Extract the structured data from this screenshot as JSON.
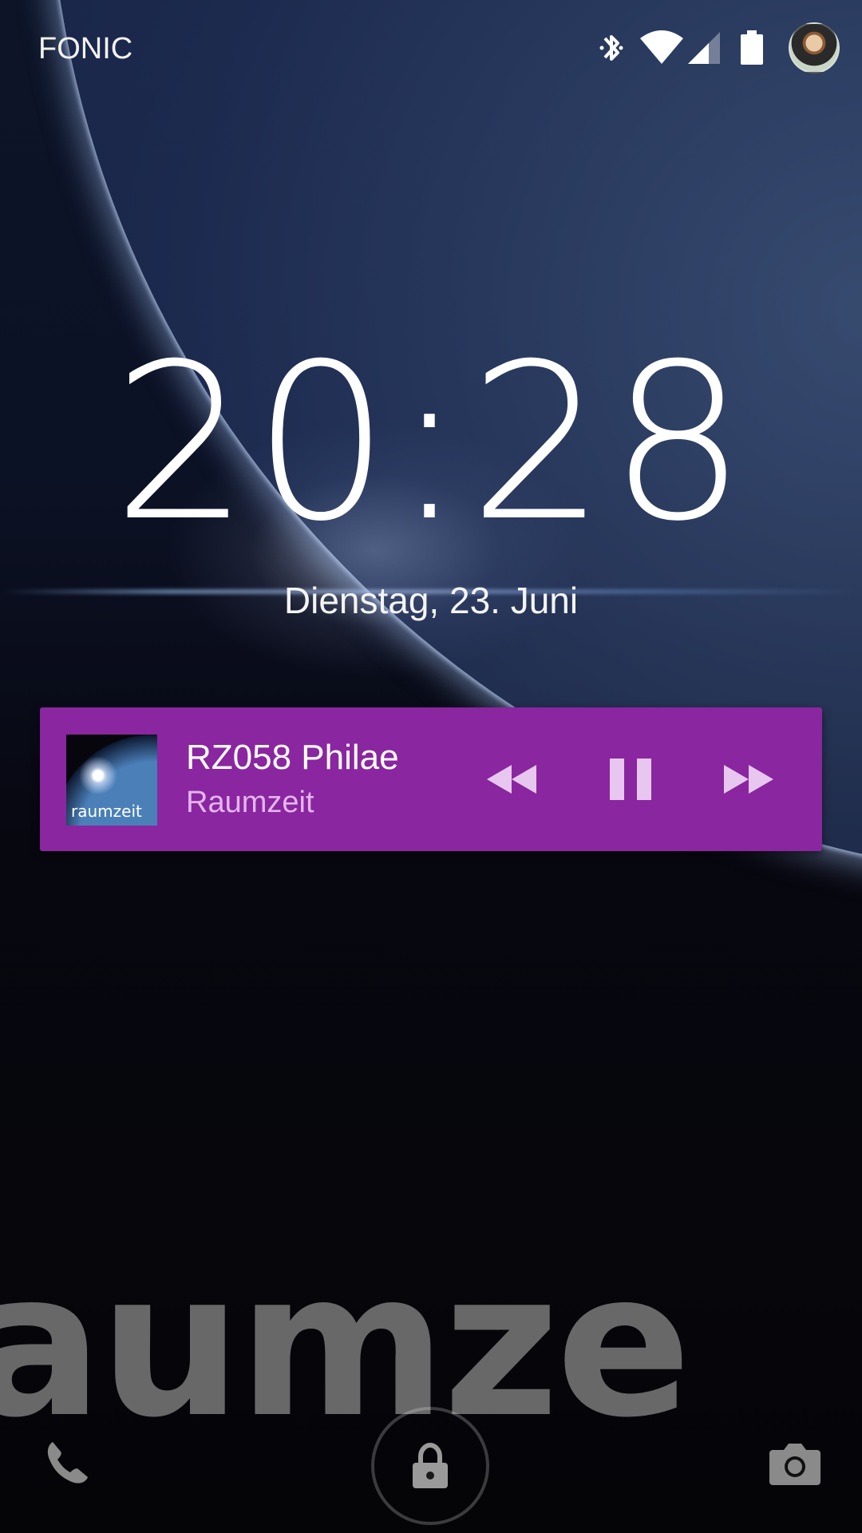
{
  "status_bar": {
    "carrier": "FONIC",
    "icons": [
      "bluetooth-icon",
      "wifi-icon",
      "cell-signal-icon",
      "battery-icon",
      "user-avatar"
    ]
  },
  "lockscreen": {
    "time": "20:28",
    "date": "Dienstag, 23. Juni"
  },
  "media_notification": {
    "title": "RZ058 Philae",
    "artist": "Raumzeit",
    "album_art_text": "raumzeit",
    "background_color": "#8a26a0",
    "controls": [
      "rewind-icon",
      "pause-icon",
      "fast-forward-icon"
    ]
  },
  "wallpaper": {
    "watermark_text": "aumze"
  },
  "bottom_actions": [
    "phone-icon",
    "lock-icon",
    "camera-icon"
  ]
}
